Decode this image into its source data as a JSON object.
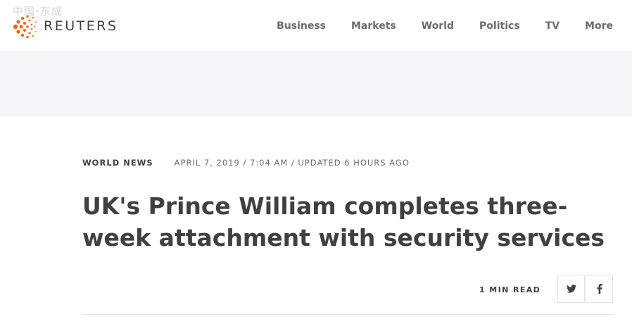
{
  "watermark": "中国·东成",
  "brand": {
    "logo_text": "REUTERS",
    "accent": "#fa6400"
  },
  "nav": {
    "items": [
      "Business",
      "Markets",
      "World",
      "Politics",
      "TV",
      "More"
    ]
  },
  "article": {
    "section": "WORLD NEWS",
    "dateline": "APRIL 7, 2019 / 7:04 AM / UPDATED 6 HOURS AGO",
    "headline": "UK's Prince William completes three-week attachment with security services",
    "read_time": "1 MIN READ"
  },
  "share": {
    "twitter_icon": "twitter-icon",
    "facebook_icon": "facebook-icon"
  }
}
